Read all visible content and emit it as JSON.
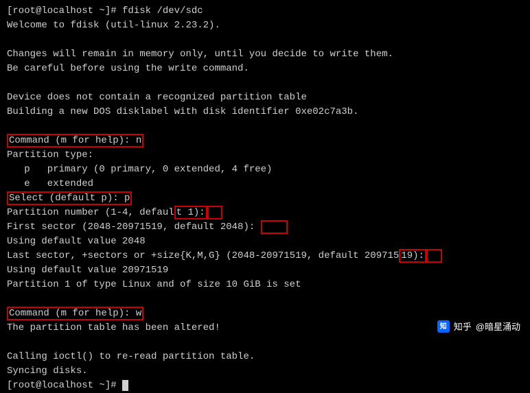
{
  "l1_prompt": "[root@localhost ~]# ",
  "l1_cmd": "fdisk /dev/sdc",
  "l2": "Welcome to fdisk (util-linux 2.23.2).",
  "l3": "",
  "l4": "Changes will remain in memory only, until you decide to write them.",
  "l5": "Be careful before using the write command.",
  "l6": "",
  "l7": "Device does not contain a recognized partition table",
  "l8": "Building a new DOS disklabel with disk identifier 0xe02c7a3b.",
  "l9": "",
  "l10_hl": "Command (m for help): n",
  "l11": "Partition type:",
  "l12": "   p   primary (0 primary, 0 extended, 4 free)",
  "l13": "   e   extended",
  "l14_hl": "Select (default p): p",
  "l15a": "Partition number (1-4, defaul",
  "l15b": "t 1):",
  "l15c": "  ",
  "l16a": "First sector (2048-20971519, default 2048): ",
  "l16b": "    ",
  "l17": "Using default value 2048",
  "l18a": "Last sector, +sectors or +size{K,M,G} (2048-20971519, default 209715",
  "l18b": "19):",
  "l18c": "  ",
  "l19": "Using default value 20971519",
  "l20": "Partition 1 of type Linux and of size 10 GiB is set",
  "l21": "",
  "l22_hl": "Command (m for help): w",
  "l23": "The partition table has been altered!",
  "l24": "",
  "l25": "Calling ioctl() to re-read partition table.",
  "l26": "Syncing disks.",
  "l27_prompt": "[root@localhost ~]# ",
  "watermark": {
    "icon": "知",
    "label_pre": "知乎 ",
    "user": "@暗星涌动"
  }
}
